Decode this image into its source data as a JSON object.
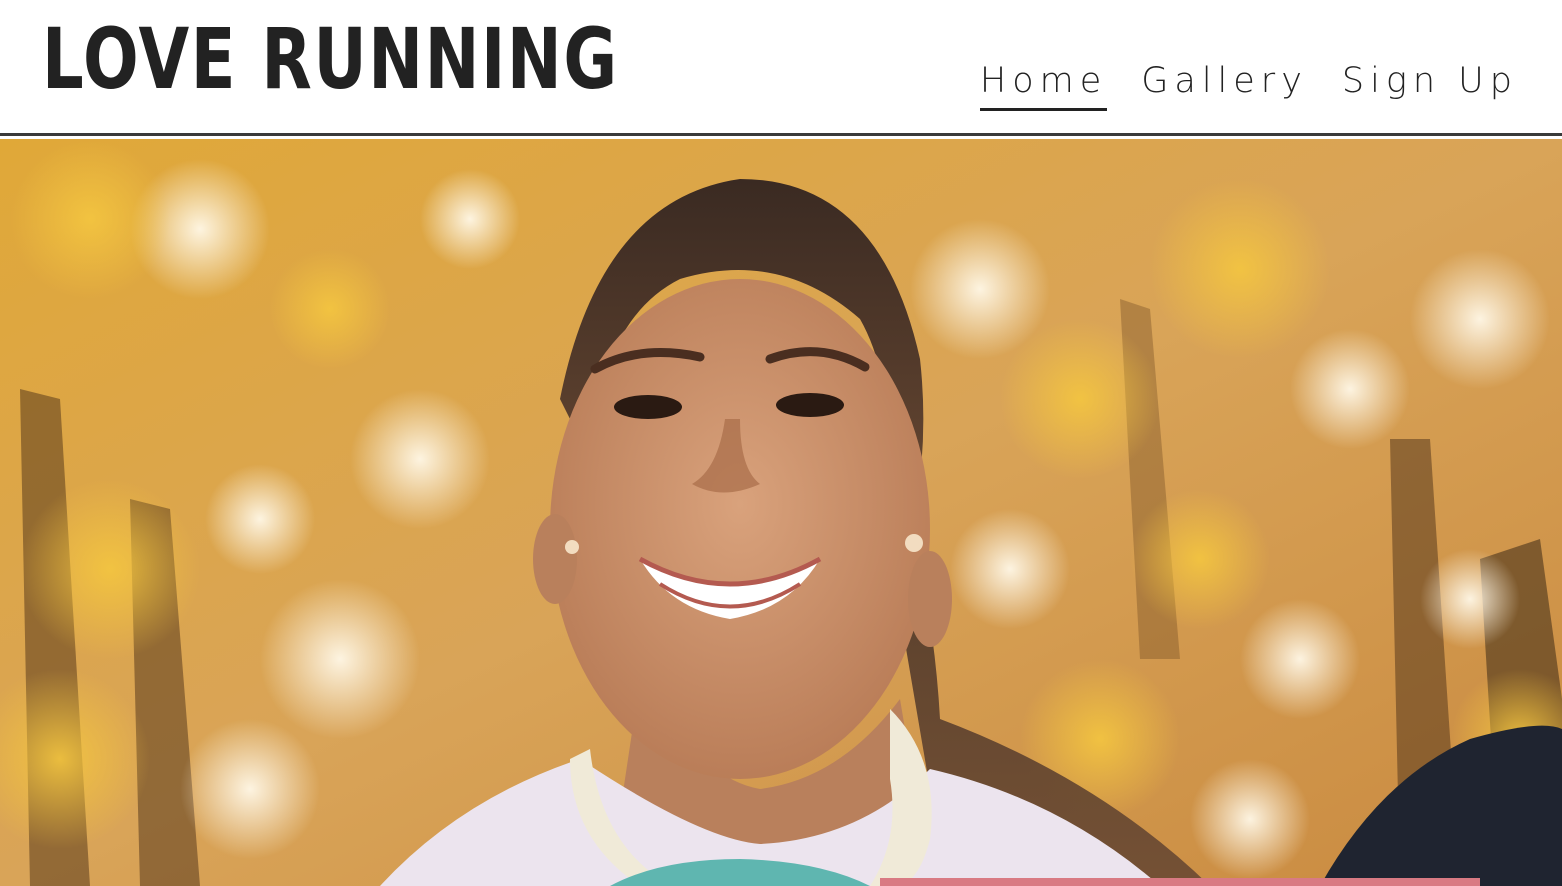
{
  "site": {
    "logo": "LOVE RUNNING"
  },
  "nav": {
    "items": [
      {
        "label": "Home",
        "active": true
      },
      {
        "label": "Gallery",
        "active": false
      },
      {
        "label": "Sign Up",
        "active": false
      }
    ]
  },
  "hero": {
    "image_subject": "smiling woman running in autumn park",
    "accent_color": "#d97a83"
  },
  "colors": {
    "text": "#222222",
    "header_border": "#3a3a3a",
    "background": "#ffffff"
  }
}
